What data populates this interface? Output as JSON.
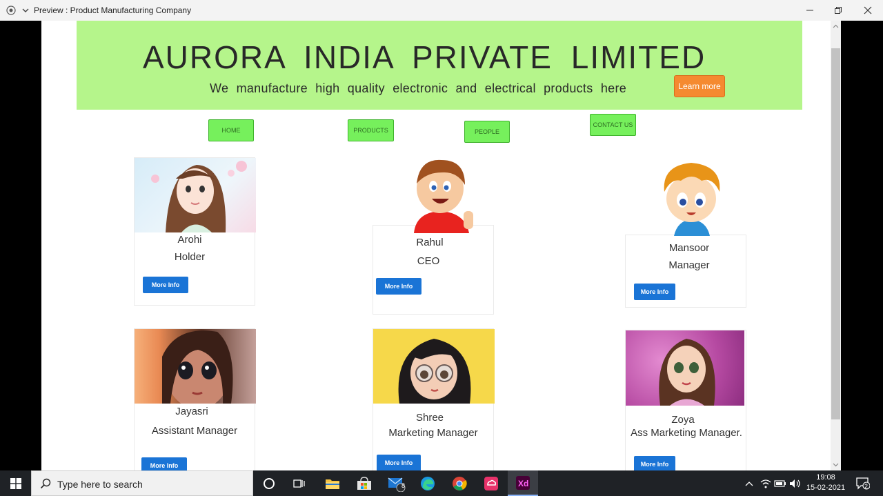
{
  "window": {
    "title": "Preview : Product Manufacturing Company"
  },
  "hero": {
    "company": "AURORA INDIA PRIVATE LIMITED",
    "tagline": "We manufacture high quality electronic and electrical products here",
    "cta": "Learn more"
  },
  "nav": [
    "HOME",
    "PRODUCTS",
    "PEOPLE",
    "CONTACT US"
  ],
  "people": [
    {
      "name": "Arohi",
      "role": "Holder",
      "button": "More Info"
    },
    {
      "name": "Rahul",
      "role": "CEO",
      "button": "More Info"
    },
    {
      "name": "Mansoor",
      "role": "Manager",
      "button": "More Info"
    },
    {
      "name": "Jayasri",
      "role": "Assistant Manager",
      "button": "More Info"
    },
    {
      "name": "Shree",
      "role": "Marketing Manager",
      "button": "More Info"
    },
    {
      "name": "Zoya",
      "role": "Ass Marketing Manager.",
      "button": "More Info"
    }
  ],
  "taskbar": {
    "search_placeholder": "Type here to search",
    "mail_badge": "8",
    "time": "19:08",
    "date": "15-02-2021",
    "notification_count": "2",
    "apps": [
      "cortana-icon",
      "task-view-icon",
      "file-explorer-icon",
      "store-icon",
      "mail-icon",
      "edge-icon",
      "chrome-icon",
      "creative-cloud-icon",
      "adobe-xd-icon"
    ]
  },
  "colors": {
    "hero_bg": "#b5f58b",
    "nav_green": "#76f05c",
    "cta_orange": "#f58a30",
    "button_blue": "#1a74d6"
  }
}
